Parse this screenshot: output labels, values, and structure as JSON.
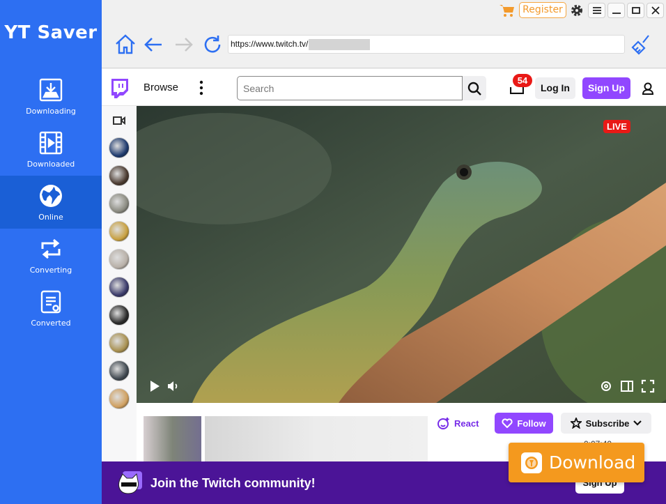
{
  "app": {
    "name": "YT Saver"
  },
  "sidebar": {
    "items": [
      {
        "label": "Downloading",
        "icon": "download-icon",
        "active": false
      },
      {
        "label": "Downloaded",
        "icon": "film-icon",
        "active": false
      },
      {
        "label": "Online",
        "icon": "globe-icon",
        "active": true
      },
      {
        "label": "Converting",
        "icon": "convert-icon",
        "active": false
      },
      {
        "label": "Converted",
        "icon": "converted-doc-icon",
        "active": false
      }
    ]
  },
  "titlebar": {
    "register_label": "Register",
    "icons": [
      "cart-icon",
      "gear-icon",
      "menu-icon",
      "minimize-icon",
      "maximize-icon",
      "close-icon"
    ]
  },
  "toolbar": {
    "url": "https://www.twitch.tv/",
    "icons": [
      "home-icon",
      "back-icon",
      "forward-icon",
      "refresh-icon",
      "broom-icon"
    ]
  },
  "twitch": {
    "browse_label": "Browse",
    "search_placeholder": "Search",
    "inbox_count": "54",
    "login_label": "Log In",
    "signup_label": "Sign Up",
    "live_label": "LIVE",
    "react_label": "React",
    "follow_label": "Follow",
    "subscribe_label": "Subscribe",
    "viewer_count": "0:07:40",
    "banner_text": "Join the Twitch community!",
    "banner_signup": "Sign Up",
    "channels": [
      {
        "color": "#1e3a6e"
      },
      {
        "color": "#4a3a30"
      },
      {
        "color": "#8a8a80"
      },
      {
        "color": "#c8a040"
      },
      {
        "color": "#b8b0a8"
      },
      {
        "color": "#3a3a6a"
      },
      {
        "color": "#2a2a2a"
      },
      {
        "color": "#a89050"
      },
      {
        "color": "#404850"
      },
      {
        "color": "#d0a060"
      }
    ]
  },
  "overlay": {
    "download_label": "Download"
  },
  "colors": {
    "brand_blue": "#2d6ff2",
    "twitch_purple": "#9147ff",
    "accent_orange": "#f4991e",
    "live_red": "#e91916"
  }
}
